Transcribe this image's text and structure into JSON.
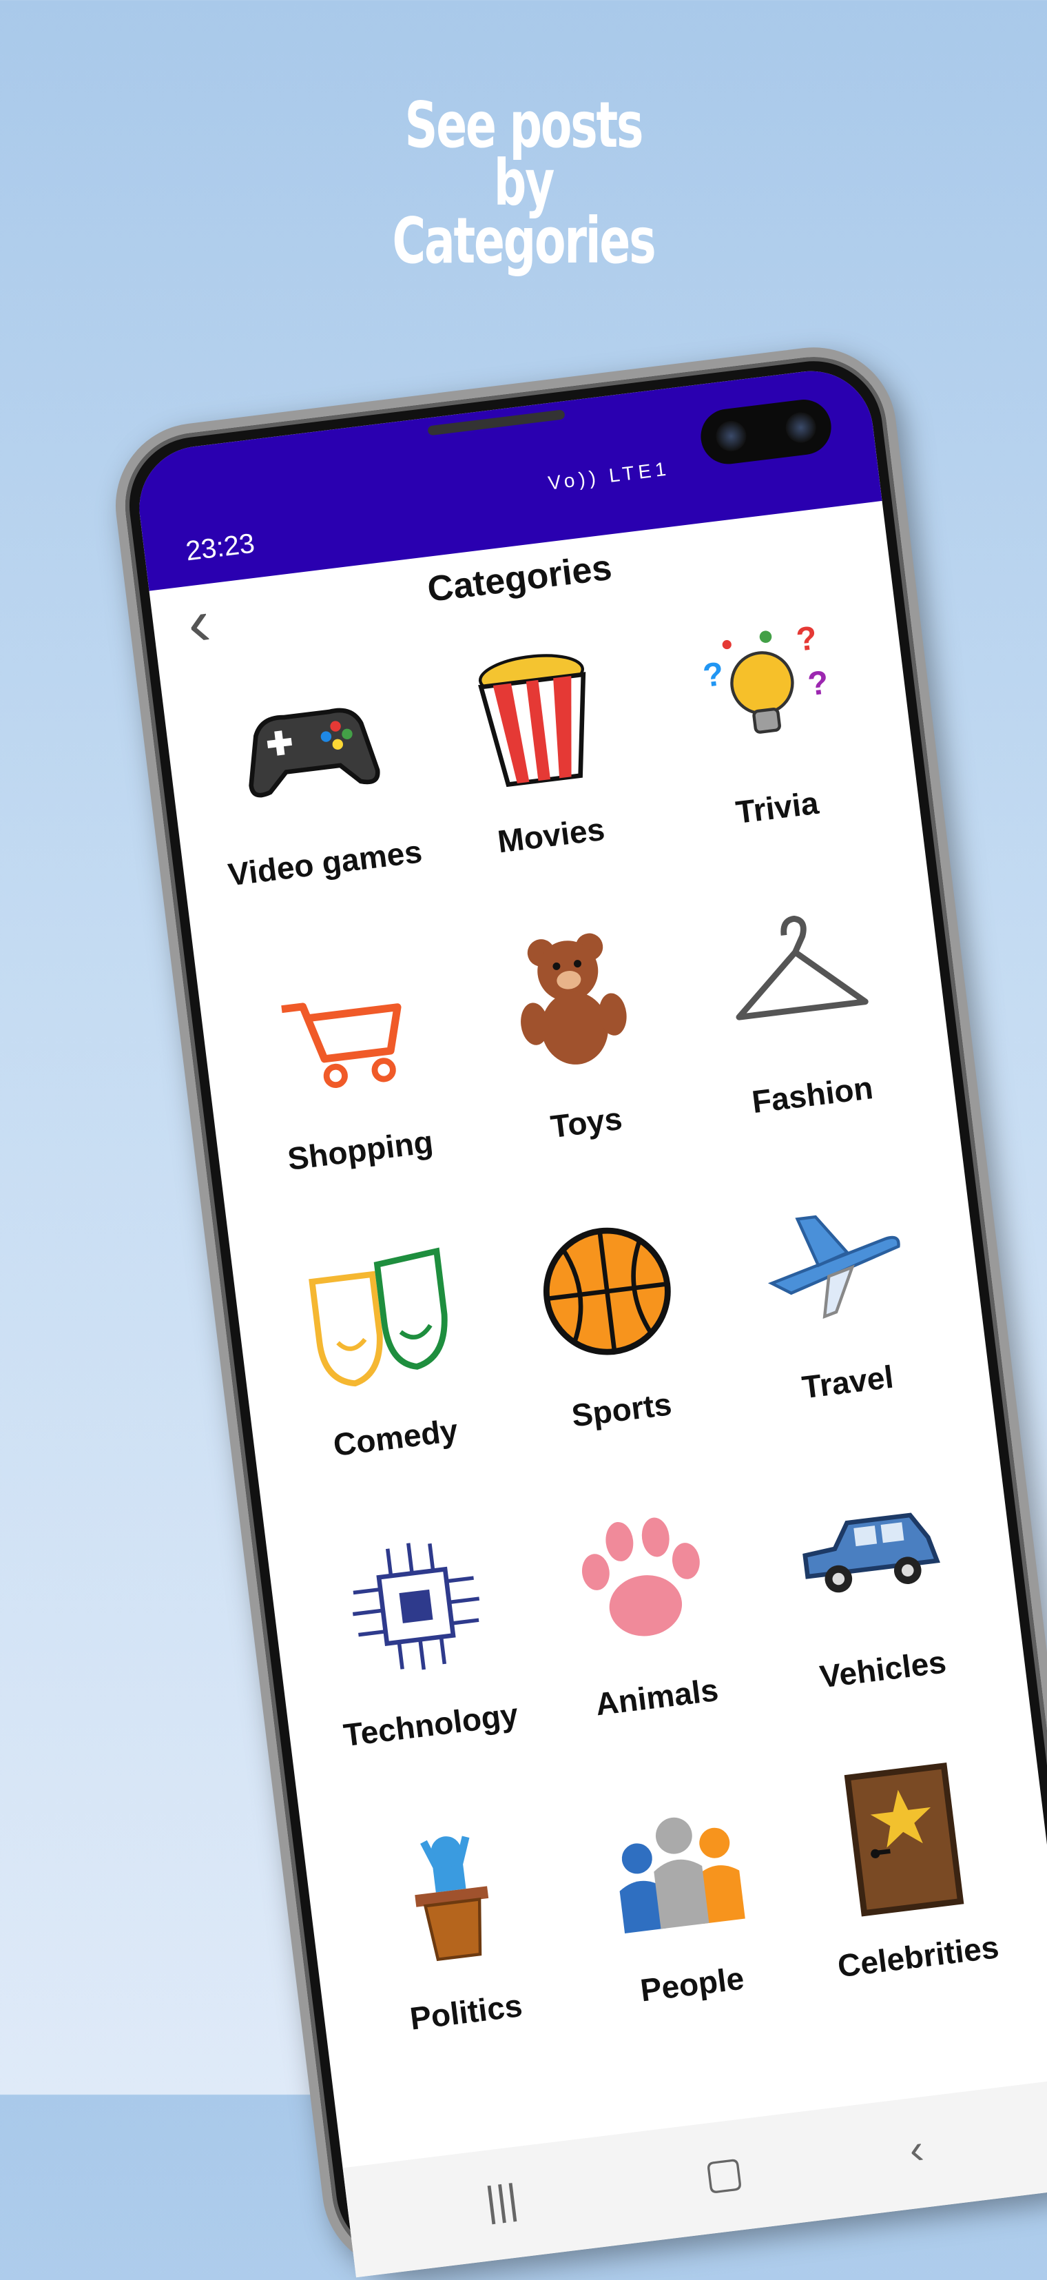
{
  "headline": {
    "line1": "See posts",
    "line2": "by",
    "line3": "Categories"
  },
  "status_bar": {
    "time": "23:23",
    "icons_text": "Vo)) LTE1"
  },
  "app_bar": {
    "title": "Categories"
  },
  "categories": [
    {
      "label": "Video games",
      "icon": "gamepad-icon"
    },
    {
      "label": "Movies",
      "icon": "popcorn-icon"
    },
    {
      "label": "Trivia",
      "icon": "lightbulb-icon"
    },
    {
      "label": "Shopping",
      "icon": "shopping-cart-icon"
    },
    {
      "label": "Toys",
      "icon": "teddy-bear-icon"
    },
    {
      "label": "Fashion",
      "icon": "hanger-icon"
    },
    {
      "label": "Comedy",
      "icon": "comedy-masks-icon"
    },
    {
      "label": "Sports",
      "icon": "basketball-icon"
    },
    {
      "label": "Travel",
      "icon": "airplane-icon"
    },
    {
      "label": "Technology",
      "icon": "chip-icon"
    },
    {
      "label": "Animals",
      "icon": "paw-icon"
    },
    {
      "label": "Vehicles",
      "icon": "car-icon"
    },
    {
      "label": "Politics",
      "icon": "podium-icon"
    },
    {
      "label": "People",
      "icon": "people-icon"
    },
    {
      "label": "Celebrities",
      "icon": "star-door-icon"
    }
  ],
  "colors": {
    "status_bar": "#2a00b0",
    "background_top": "#a9c9ea",
    "background_bottom": "#dfeaf8"
  }
}
